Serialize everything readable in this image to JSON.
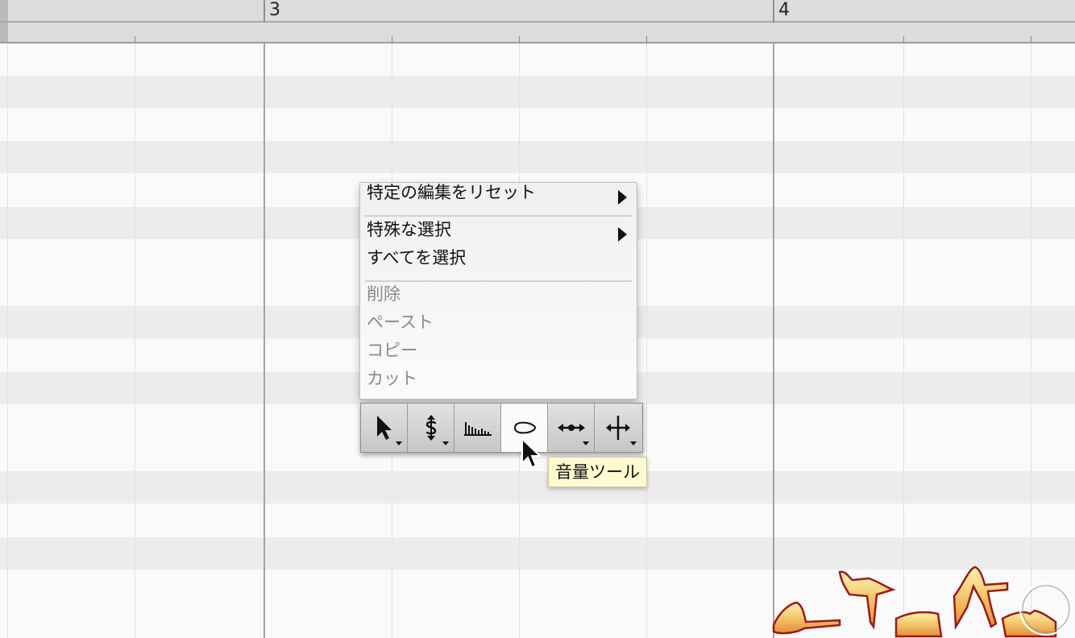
{
  "ruler": {
    "bar_3": "3",
    "bar_4": "4"
  },
  "context_menu": {
    "items": [
      {
        "label": "特定の編集をリセット",
        "submenu": true,
        "enabled": true
      },
      {
        "label": "特殊な選択",
        "submenu": true,
        "enabled": true
      },
      {
        "label": "すべてを選択",
        "submenu": false,
        "enabled": true
      },
      {
        "label": "削除",
        "submenu": false,
        "enabled": false
      },
      {
        "label": "ペースト",
        "submenu": false,
        "enabled": false
      },
      {
        "label": "コピー",
        "submenu": false,
        "enabled": false
      },
      {
        "label": "カット",
        "submenu": false,
        "enabled": false
      }
    ]
  },
  "toolbar": {
    "tools": [
      {
        "icon": "arrow-pointer-icon",
        "has_dropdown": true,
        "active": false
      },
      {
        "icon": "pitch-tool-icon",
        "has_dropdown": true,
        "active": false
      },
      {
        "icon": "formant-tool-icon",
        "has_dropdown": false,
        "active": false
      },
      {
        "icon": "amplitude-tool-icon",
        "has_dropdown": false,
        "active": true
      },
      {
        "icon": "time-tool-icon",
        "has_dropdown": true,
        "active": false
      },
      {
        "icon": "separation-tool-icon",
        "has_dropdown": true,
        "active": false
      }
    ],
    "tooltip": "音量ツール"
  },
  "colors": {
    "blob_fill": "#f2c66a",
    "blob_stroke": "#9b1a1a",
    "tooltip_bg": "#fffbd0"
  }
}
